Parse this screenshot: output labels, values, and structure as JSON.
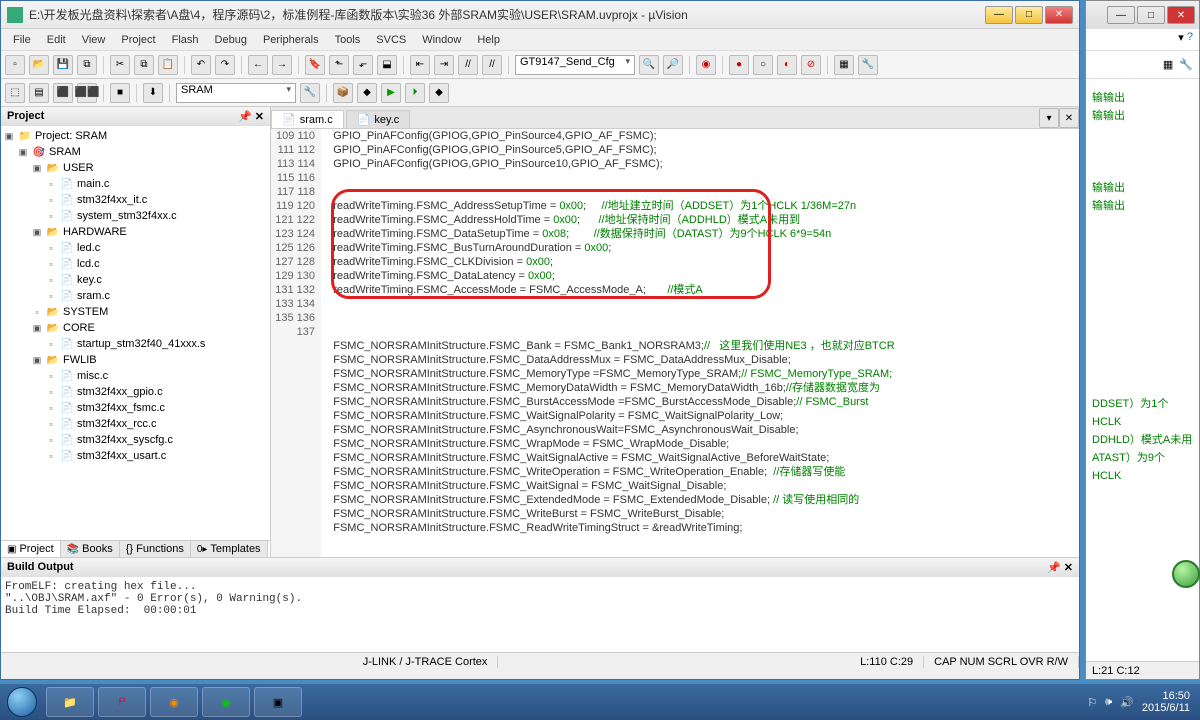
{
  "titlebar": {
    "title": "E:\\开发板光盘资料\\探索者\\A盘\\4，程序源码\\2，标准例程-库函数版本\\实验36 外部SRAM实验\\USER\\SRAM.uvprojx - µVision"
  },
  "menu": [
    "File",
    "Edit",
    "View",
    "Project",
    "Flash",
    "Debug",
    "Peripherals",
    "Tools",
    "SVCS",
    "Window",
    "Help"
  ],
  "toolbar": {
    "config_combo": "GT9147_Send_Cfg",
    "target_combo": "SRAM"
  },
  "project_panel": {
    "title": "Project",
    "root": "Project: SRAM",
    "target": "SRAM",
    "groups": [
      {
        "name": "USER",
        "files": [
          "main.c",
          "stm32f4xx_it.c",
          "system_stm32f4xx.c"
        ]
      },
      {
        "name": "HARDWARE",
        "files": [
          "led.c",
          "lcd.c",
          "key.c",
          "sram.c"
        ]
      },
      {
        "name": "SYSTEM",
        "files": []
      },
      {
        "name": "CORE",
        "files": [
          "startup_stm32f40_41xxx.s"
        ]
      },
      {
        "name": "FWLIB",
        "files": [
          "misc.c",
          "stm32f4xx_gpio.c",
          "stm32f4xx_fsmc.c",
          "stm32f4xx_rcc.c",
          "stm32f4xx_syscfg.c",
          "stm32f4xx_usart.c"
        ]
      }
    ],
    "tabs": [
      "Project",
      "Books",
      "{} Functions",
      "Templates"
    ]
  },
  "editor": {
    "tabs": [
      {
        "name": "sram.c",
        "active": true
      },
      {
        "name": "key.c",
        "active": false
      }
    ],
    "first_line": 109,
    "lines": [
      "    GPIO_PinAFConfig(GPIOG,GPIO_PinSource4,GPIO_AF_FSMC);",
      "    GPIO_PinAFConfig(GPIOG,GPIO_PinSource5,GPIO_AF_FSMC);",
      "    GPIO_PinAFConfig(GPIOG,GPIO_PinSource10,GPIO_AF_FSMC);",
      "",
      "",
      "    readWriteTiming.FSMC_AddressSetupTime = 0x00;     //地址建立时间（ADDSET）为1个HCLK 1/36M=27n",
      "    readWriteTiming.FSMC_AddressHoldTime = 0x00;      //地址保持时间（ADDHLD）模式A未用到",
      "    readWriteTiming.FSMC_DataSetupTime = 0x08;        //数据保持时间（DATAST）为9个HCLK 6*9=54n",
      "    readWriteTiming.FSMC_BusTurnAroundDuration = 0x00;",
      "    readWriteTiming.FSMC_CLKDivision = 0x00;",
      "    readWriteTiming.FSMC_DataLatency = 0x00;",
      "    readWriteTiming.FSMC_AccessMode = FSMC_AccessMode_A;       //模式A",
      "",
      "",
      "",
      "    FSMC_NORSRAMInitStructure.FSMC_Bank = FSMC_Bank1_NORSRAM3;//   这里我们使用NE3 ，也就对应BTCR",
      "    FSMC_NORSRAMInitStructure.FSMC_DataAddressMux = FSMC_DataAddressMux_Disable;",
      "    FSMC_NORSRAMInitStructure.FSMC_MemoryType =FSMC_MemoryType_SRAM;// FSMC_MemoryType_SRAM;",
      "    FSMC_NORSRAMInitStructure.FSMC_MemoryDataWidth = FSMC_MemoryDataWidth_16b;//存储器数据宽度为",
      "    FSMC_NORSRAMInitStructure.FSMC_BurstAccessMode =FSMC_BurstAccessMode_Disable;// FSMC_Burst",
      "    FSMC_NORSRAMInitStructure.FSMC_WaitSignalPolarity = FSMC_WaitSignalPolarity_Low;",
      "    FSMC_NORSRAMInitStructure.FSMC_AsynchronousWait=FSMC_AsynchronousWait_Disable;",
      "    FSMC_NORSRAMInitStructure.FSMC_WrapMode = FSMC_WrapMode_Disable;",
      "    FSMC_NORSRAMInitStructure.FSMC_WaitSignalActive = FSMC_WaitSignalActive_BeforeWaitState;",
      "    FSMC_NORSRAMInitStructure.FSMC_WriteOperation = FSMC_WriteOperation_Enable;  //存储器写使能",
      "    FSMC_NORSRAMInitStructure.FSMC_WaitSignal = FSMC_WaitSignal_Disable;",
      "    FSMC_NORSRAMInitStructure.FSMC_ExtendedMode = FSMC_ExtendedMode_Disable; // 读写使用相同的",
      "    FSMC_NORSRAMInitStructure.FSMC_WriteBurst = FSMC_WriteBurst_Disable;",
      "    FSMC_NORSRAMInitStructure.FSMC_ReadWriteTimingStruct = &readWriteTiming;"
    ]
  },
  "build_output": {
    "title": "Build Output",
    "lines": [
      "FromELF: creating hex file...",
      "\"..\\OBJ\\SRAM.axf\" - 0 Error(s), 0 Warning(s).",
      "Build Time Elapsed:  00:00:01"
    ]
  },
  "statusbar": {
    "debugger": "J-LINK / J-TRACE Cortex",
    "pos": "L:110 C:29",
    "indicators": "CAP  NUM  SCRL  OVR  R/W"
  },
  "bg_window": {
    "snippets": [
      "输输出",
      "输输出",
      "输输出",
      "输输出",
      "DDSET）为1个HCLK",
      "DDHLD）模式A未用",
      "ATAST）为9个HCLK"
    ],
    "status_pos": "L:21 C:12"
  },
  "taskbar": {
    "time": "16:50",
    "date": "2015/6/11"
  }
}
